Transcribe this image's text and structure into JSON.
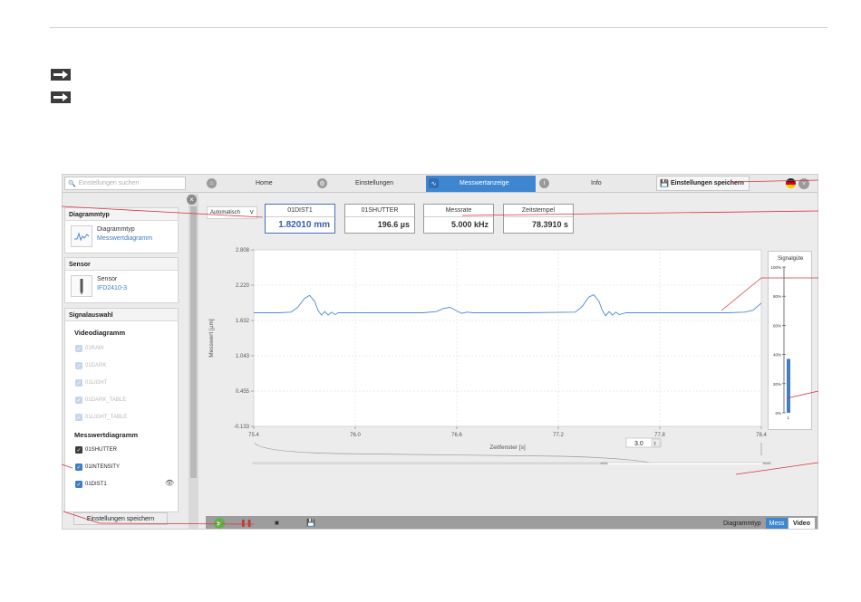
{
  "search": {
    "placeholder": "Einstellungen suchen"
  },
  "nav": {
    "tabs": [
      {
        "label": "Home",
        "icon": "home-icon"
      },
      {
        "label": "Einstellungen",
        "icon": "gear-icon"
      },
      {
        "label": "Messwertanzeige",
        "icon": "signal-icon"
      },
      {
        "label": "Info",
        "icon": "info-icon"
      }
    ],
    "save": "Einstellungen speichern",
    "active_color": "#3f86d0"
  },
  "sidebar": {
    "diagrammtyp": {
      "header": "Diagrammtyp",
      "title": "Diagrammtyp",
      "value": "Messwertdiagramm"
    },
    "sensor": {
      "header": "Sensor",
      "title": "Sensor",
      "value": "IFD2410-3"
    },
    "signal": {
      "header": "Signalauswahl",
      "video_title": "Videodiagramm",
      "video_items": [
        "01RAW",
        "01DARK",
        "01LIGHT",
        "01DARK_TABLE",
        "01LIGHT_TABLE"
      ],
      "mess_title": "Messwertdiagramm",
      "mess_items": [
        "01SHUTTER",
        "01INTENSITY",
        "01DIST1"
      ]
    },
    "save": "Einstellungen speichern"
  },
  "measure": {
    "dropdown": "Automatisch",
    "boxes": [
      {
        "title": "01DIST1",
        "value": "1.82010 mm"
      },
      {
        "title": "01SHUTTER",
        "value": "196.6  µs"
      },
      {
        "title": "Messrate",
        "value": "5.000  kHz"
      },
      {
        "title": "Zeitstempel",
        "value": "78.3910  s"
      }
    ]
  },
  "window": {
    "value": "3.0"
  },
  "signal_quality": {
    "title": "Signalgüte",
    "ticks": [
      "100%",
      "80%",
      "60%",
      "40%",
      "20%",
      "0%"
    ],
    "level_percent": 37,
    "channel": "1"
  },
  "bottom": {
    "diagramtype_label": "Diagrammtyp",
    "mess": "Mess",
    "video": "Video"
  },
  "chart_data": {
    "type": "line",
    "ylabel": "Messwert [µm]",
    "xlabel": "Zeitfenster [s]",
    "yticks": [
      "2.808",
      "2.220",
      "1.632",
      "1.043",
      "0.455",
      "-0.133"
    ],
    "xticks": [
      "75.4",
      "76.0",
      "76.6",
      "77.2",
      "77.8",
      "78.4"
    ],
    "xlim": [
      75.4,
      78.4
    ],
    "ylim": [
      -0.133,
      2.808
    ],
    "grid": true,
    "color": "#4a8bd6",
    "series": [
      {
        "points": [
          [
            75.4,
            1.76
          ],
          [
            75.55,
            1.76
          ],
          [
            75.62,
            1.77
          ],
          [
            75.66,
            1.85
          ],
          [
            75.7,
            2.0
          ],
          [
            75.73,
            2.05
          ],
          [
            75.76,
            1.95
          ],
          [
            75.78,
            1.8
          ],
          [
            75.8,
            1.72
          ],
          [
            75.82,
            1.78
          ],
          [
            75.84,
            1.72
          ],
          [
            75.86,
            1.77
          ],
          [
            75.88,
            1.73
          ],
          [
            75.9,
            1.76
          ],
          [
            76.0,
            1.76
          ],
          [
            76.2,
            1.76
          ],
          [
            76.4,
            1.76
          ],
          [
            76.48,
            1.78
          ],
          [
            76.52,
            1.83
          ],
          [
            76.56,
            1.85
          ],
          [
            76.6,
            1.79
          ],
          [
            76.63,
            1.75
          ],
          [
            76.66,
            1.77
          ],
          [
            76.7,
            1.76
          ],
          [
            77.0,
            1.76
          ],
          [
            77.3,
            1.77
          ],
          [
            77.34,
            1.86
          ],
          [
            77.38,
            2.02
          ],
          [
            77.41,
            2.06
          ],
          [
            77.44,
            1.95
          ],
          [
            77.46,
            1.8
          ],
          [
            77.48,
            1.71
          ],
          [
            77.5,
            1.78
          ],
          [
            77.52,
            1.72
          ],
          [
            77.54,
            1.77
          ],
          [
            77.56,
            1.73
          ],
          [
            77.6,
            1.76
          ],
          [
            77.8,
            1.76
          ],
          [
            78.0,
            1.76
          ],
          [
            78.2,
            1.76
          ],
          [
            78.3,
            1.77
          ],
          [
            78.35,
            1.8
          ],
          [
            78.4,
            1.92
          ]
        ]
      }
    ]
  }
}
